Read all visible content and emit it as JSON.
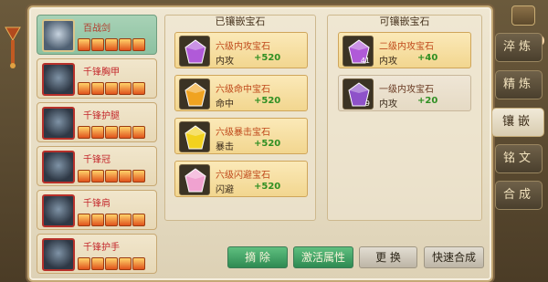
{
  "equipment": [
    {
      "name": "百战剑",
      "stars": 5,
      "active": true
    },
    {
      "name": "千锋胸甲",
      "stars": 5,
      "active": false
    },
    {
      "name": "千锋护腿",
      "stars": 5,
      "active": false
    },
    {
      "name": "千锋冠",
      "stars": 5,
      "active": false
    },
    {
      "name": "千锋肩",
      "stars": 5,
      "active": false
    },
    {
      "name": "千锋护手",
      "stars": 5,
      "active": false
    }
  ],
  "inlaid_panel": {
    "title": "已镶嵌宝石",
    "gems": [
      {
        "name": "六级内攻宝石",
        "attr": "内攻",
        "value": "+520",
        "color": "#b05ad8",
        "icon": "purple-gem-icon"
      },
      {
        "name": "六级命中宝石",
        "attr": "命中",
        "value": "+520",
        "color": "#f0a321",
        "icon": "orange-gem-icon"
      },
      {
        "name": "六级暴击宝石",
        "attr": "暴击",
        "value": "+520",
        "color": "#f2d21e",
        "icon": "yellow-gem-icon"
      },
      {
        "name": "六级闪避宝石",
        "attr": "闪避",
        "value": "+520",
        "color": "#f0a2d0",
        "icon": "pink-gem-icon"
      }
    ]
  },
  "available_panel": {
    "title": "可镶嵌宝石",
    "gems": [
      {
        "name": "二级内攻宝石",
        "attr": "内攻",
        "value": "+40",
        "count": "41",
        "color": "#b05ad8",
        "icon": "purple-gem-icon",
        "highlight": true
      },
      {
        "name": "一级内攻宝石",
        "attr": "内攻",
        "value": "+20",
        "count": "9",
        "color": "#8e52c9",
        "icon": "purple-gem-icon",
        "highlight": false
      }
    ]
  },
  "side_tabs": [
    {
      "label": "淬炼",
      "active": false
    },
    {
      "label": "精炼",
      "active": false
    },
    {
      "label": "镶嵌",
      "active": true
    },
    {
      "label": "铭文",
      "active": false
    },
    {
      "label": "合成",
      "active": false
    }
  ],
  "buttons": {
    "remove": "摘 除",
    "activate": "激活属性",
    "replace": "更 换",
    "quick_combine": "快速合成"
  },
  "colors": {
    "active_tab_bg": "#e7dcc3",
    "green_button": "#3f9f64",
    "value_green": "#2f8f22"
  }
}
